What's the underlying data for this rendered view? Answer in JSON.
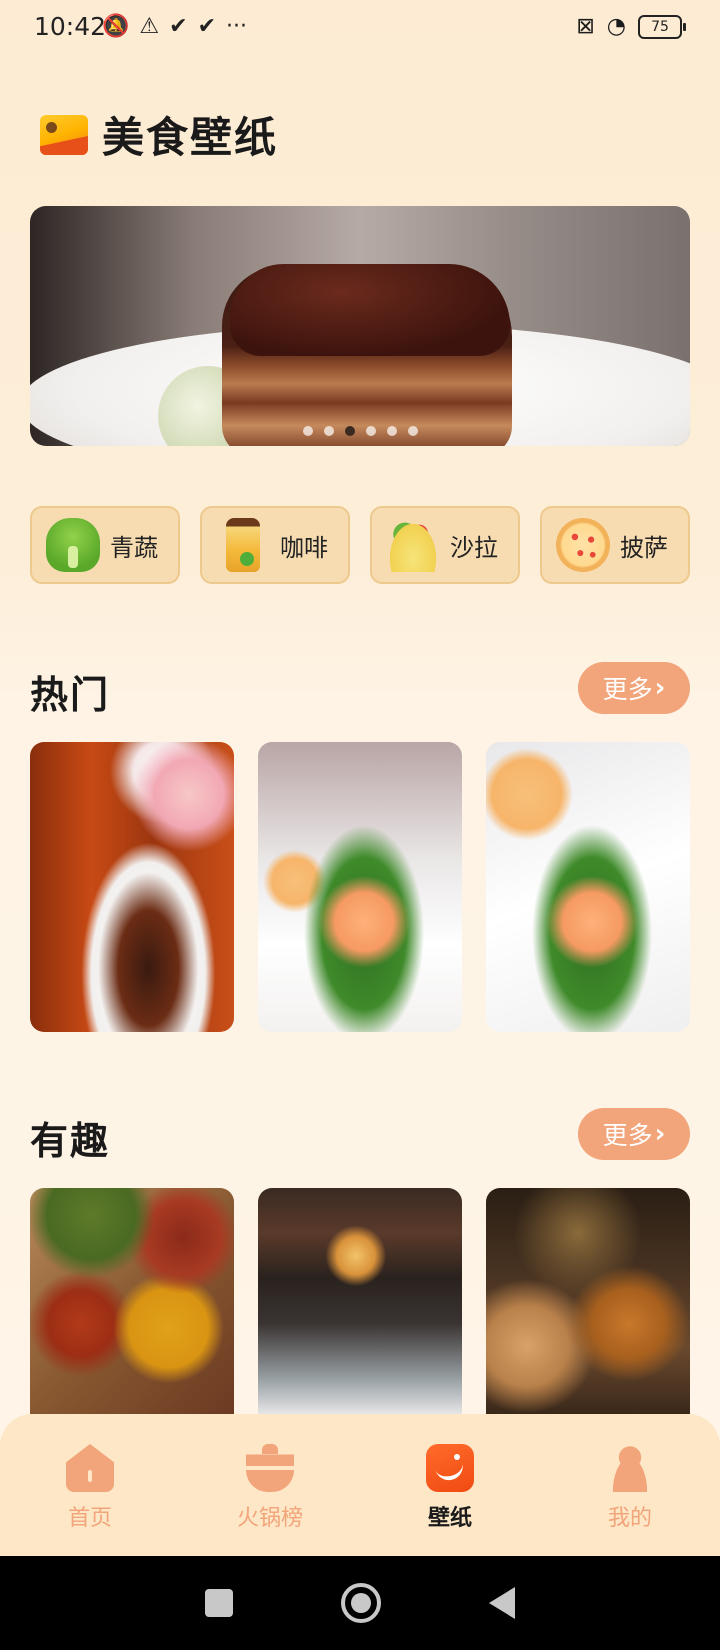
{
  "status_bar": {
    "time": "10:42",
    "left_icons": [
      "mute-icon",
      "alert-icon",
      "check-icon",
      "check-icon",
      "more-icon"
    ],
    "right_icons": [
      "no-sim-icon",
      "wifi-icon"
    ],
    "battery": "75"
  },
  "header": {
    "title": "美食壁纸",
    "icon": "image-icon"
  },
  "banner": {
    "dots": 6,
    "active_dot_index": 2
  },
  "categories": [
    {
      "label": "青蔬",
      "icon": "vegetable-icon"
    },
    {
      "label": "咖啡",
      "icon": "coffee-icon"
    },
    {
      "label": "沙拉",
      "icon": "salad-icon"
    },
    {
      "label": "披萨",
      "icon": "pizza-icon"
    }
  ],
  "sections": [
    {
      "title": "热门",
      "more_label": "更多",
      "images": [
        "stew-dish-photo",
        "shrimp-broccoli-photo",
        "shrimp-broccoli-photo"
      ]
    },
    {
      "title": "有趣",
      "more_label": "更多",
      "images": [
        "spices-photo",
        "restaurant-kitchen-photo",
        "dim-sum-photo"
      ]
    }
  ],
  "bottom_nav": [
    {
      "label": "首页",
      "icon": "home-icon",
      "active": false
    },
    {
      "label": "火锅榜",
      "icon": "hotpot-icon",
      "active": false
    },
    {
      "label": "壁纸",
      "icon": "wallpaper-icon",
      "active": true
    },
    {
      "label": "我的",
      "icon": "profile-icon",
      "active": false
    }
  ],
  "colors": {
    "accent": "#f2a47a",
    "active_icon": "#f04a12",
    "background": "#fdecd3",
    "category_bg": "#f7dcb1"
  }
}
